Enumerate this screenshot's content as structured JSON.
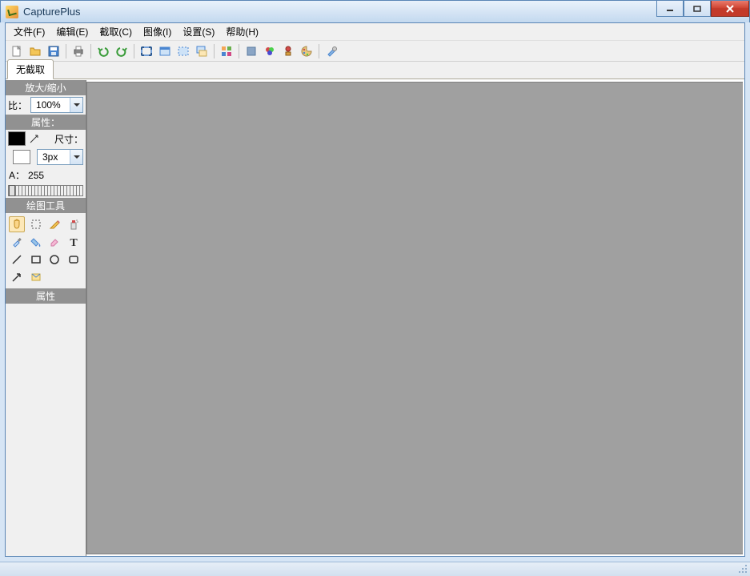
{
  "window": {
    "title": "CapturePlus"
  },
  "menu": {
    "file": "文件(F)",
    "edit": "编辑(E)",
    "capture": "截取(C)",
    "image": "图像(I)",
    "settings": "设置(S)",
    "help": "帮助(H)"
  },
  "tab": {
    "no_capture": "无截取"
  },
  "zoom": {
    "header": "放大/缩小",
    "label": "比：",
    "value": "100%"
  },
  "attributes": {
    "header": "属性：",
    "size_label": "尺寸：",
    "size_value": "3px",
    "alpha_label": "A：",
    "alpha_value": "255"
  },
  "tools": {
    "header": "绘图工具"
  },
  "properties": {
    "header": "属性"
  }
}
